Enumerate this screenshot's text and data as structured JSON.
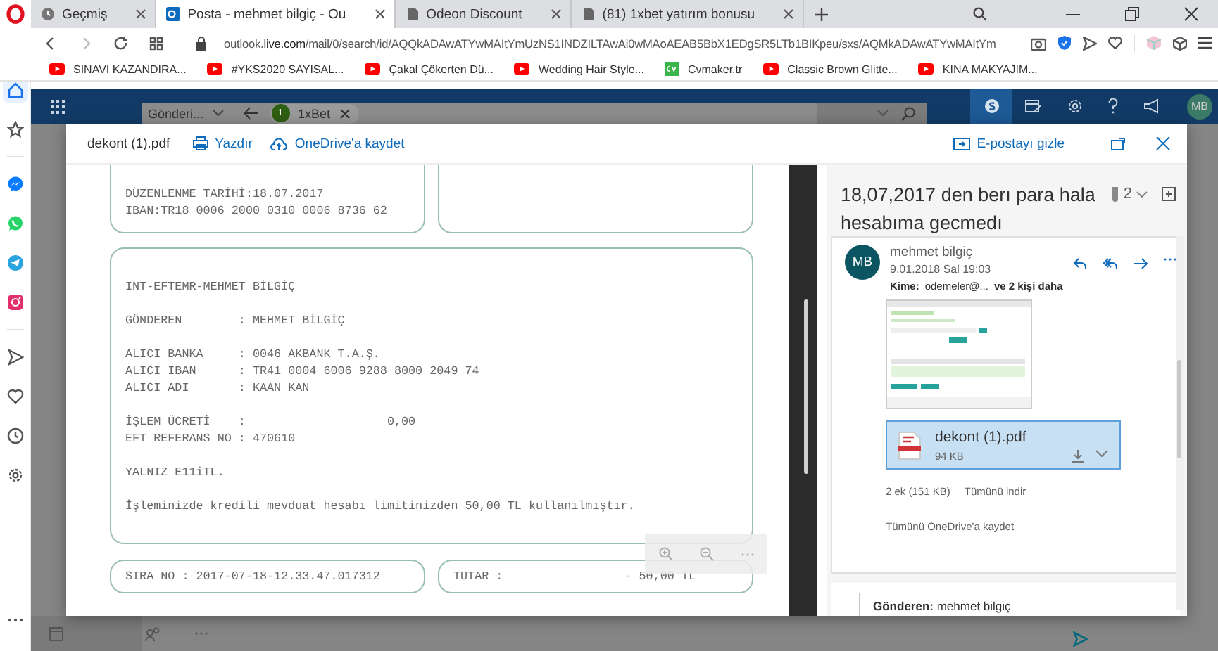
{
  "browser": {
    "tabs": [
      {
        "title": "Geçmiş",
        "kind": "history",
        "selected": false
      },
      {
        "title": "Posta - mehmet bilgiç - Ou",
        "kind": "mail",
        "selected": true
      },
      {
        "title": "Odeon Discount",
        "kind": "page",
        "selected": false
      },
      {
        "title": "(81) 1xbet yatırım bonusu",
        "kind": "page",
        "selected": false
      }
    ],
    "url": "outlook.**live.com**/mail/0/search/id/AQQkADAwATYwMAItYmUzNS1INDZILTAwAi0wMAoAEAB5BbX1EDgSR5LTb1BIKpeu/sxs/AQMkADAwATYwMAItYm",
    "bookmarks": [
      {
        "title": "SINAVI KAZANDIRA...",
        "kind": "video"
      },
      {
        "title": "#YKS2020 SAYISAL...",
        "kind": "video"
      },
      {
        "title": "Çakal Çökerten Dü...",
        "kind": "video"
      },
      {
        "title": "Wedding Hair Style...",
        "kind": "video"
      },
      {
        "title": "Cvmaker.tr",
        "kind": "cv"
      },
      {
        "title": "Classic Brown Glitte...",
        "kind": "video"
      },
      {
        "title": "KINA MAKYAJIM...",
        "kind": "video"
      }
    ]
  },
  "sidebar": {
    "groups": [
      [
        {
          "kind": "home",
          "selected": true
        },
        {
          "kind": "star",
          "selected": false
        }
      ],
      [
        {
          "kind": "messenger",
          "selected": false
        },
        {
          "kind": "whatsapp",
          "selected": false
        },
        {
          "kind": "telegram",
          "selected": false
        },
        {
          "kind": "instagram",
          "selected": false
        }
      ],
      [
        {
          "kind": "flow",
          "selected": false
        },
        {
          "kind": "heart",
          "selected": false
        },
        {
          "kind": "clock",
          "selected": false
        },
        {
          "kind": "settings",
          "selected": false
        }
      ]
    ]
  },
  "outlook": {
    "search_scope": "Gönderi...",
    "tab": {
      "badge": "1",
      "label": "1xBet"
    },
    "avatar": "MB"
  },
  "viewer": {
    "filename": "dekont (1).pdf",
    "print": "Yazdır",
    "save": "OneDrive'a kaydet",
    "hide_mail": "E-postayı gizle",
    "document": {
      "top_left": [
        "DÜZENLENME TARİHİ:18.07.2017",
        "IBAN:TR18 0006 2000 0310 0006 8736 62"
      ],
      "main": [
        [
          "INT-EFTEMR-MEHMET BİLGİÇ"
        ],
        [
          "GÖNDEREN        : MEHMET BİLGİÇ"
        ],
        [
          "ALICI BANKA     : 0046 AKBANK T.A.Ş.",
          "ALICI IBAN      : TR41 0004 6006 9288 8000 2049 74",
          "ALICI ADI       : KAAN KAN"
        ],
        [
          "İŞLEM ÜCRETİ    :                    0,00",
          "EFT REFERANS NO : 470610"
        ],
        [
          "YALNIZ E11iTL."
        ],
        [
          "İşleminizde kredili mevduat hesabı limitinizden 50,00 TL kullanılmıştır."
        ]
      ],
      "sequence": "SIRA NO : 2017-07-18-12.33.47.017312",
      "total_label": "TUTAR :",
      "total_value": "- 50,00 TL"
    }
  },
  "mail": {
    "subject": "18,07,2017 den berı para hala hesabıma gecmedı",
    "attachment_count": "2",
    "sender_initials": "MB",
    "sender": "mehmet bilgiç",
    "date": "9.01.2018 Sal 19:03",
    "to_label": "Kime:",
    "to": "odemeler@...",
    "to_more": "ve 2 kişi daha",
    "attachment": {
      "name": "dekont (1).pdf",
      "size": "94 KB",
      "selected": true
    },
    "attachments_summary": "2 ek (151 KB)",
    "download_all": "Tümünü indir",
    "save_all": "Tümünü OneDrive'a kaydet",
    "quoted": "**Gönderen:** mehmet bilgiç"
  }
}
